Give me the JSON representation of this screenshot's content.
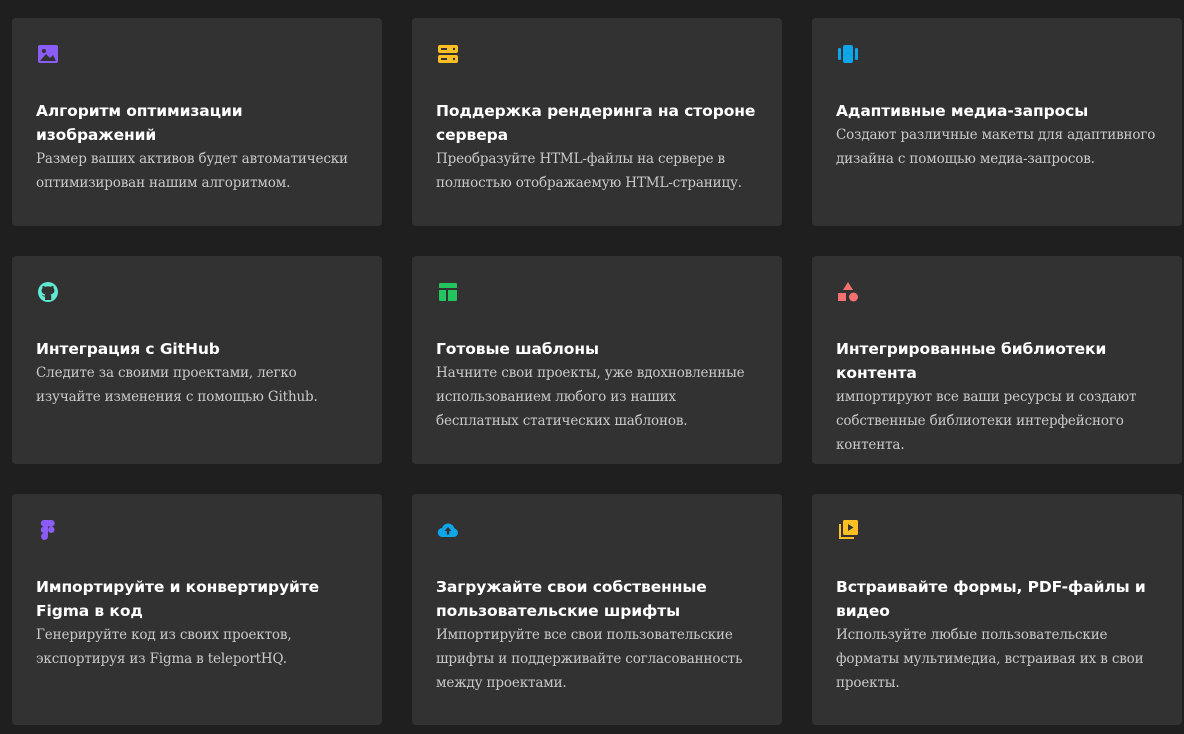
{
  "cards": [
    {
      "icon": "image-icon",
      "icon_color": "#8b5cf6",
      "title": "Алгоритм оптимизации изображений",
      "description": "Размер ваших активов будет автоматически оптимизирован нашим алгоритмом."
    },
    {
      "icon": "server-icon",
      "icon_color": "#fbbf24",
      "title": "Поддержка рендеринга на стороне сервера",
      "description": "Преобразуйте HTML-файлы на сервере в полностью отображаемую HTML-страницу."
    },
    {
      "icon": "responsive-icon",
      "icon_color": "#0ea5e9",
      "title": "Адаптивные медиа-запросы",
      "description": "Создают различные макеты для адаптивного дизайна с помощью медиа-запросов."
    },
    {
      "icon": "github-icon",
      "icon_color": "#5eead4",
      "title": "Интеграция с GitHub",
      "description": "Следите за своими проектами, легко изучайте изменения с помощью Github."
    },
    {
      "icon": "template-icon",
      "icon_color": "#22c55e",
      "title": "Готовые шаблоны",
      "description": "Начните свои проекты, уже вдохновленные использованием любого из наших бесплатных статических шаблонов."
    },
    {
      "icon": "shapes-icon",
      "icon_color": "#f87171",
      "title": "Интегрированные библиотеки контента",
      "description": "импортируют все ваши ресурсы и создают собственные библиотеки интерфейсного контента."
    },
    {
      "icon": "figma-icon",
      "icon_color": "#8b5cf6",
      "title": "Импортируйте и конвертируйте Figma в код",
      "description": "Генерируйте код из своих проектов, экспортируя из Figma в teleportHQ."
    },
    {
      "icon": "cloud-upload-icon",
      "icon_color": "#0ea5e9",
      "title": "Загружайте свои собственные пользовательские шрифты",
      "description": "Импортируйте все свои пользовательские шрифты и поддерживайте согласованность между проектами."
    },
    {
      "icon": "video-library-icon",
      "icon_color": "#fbbf24",
      "title": "Встраивайте формы, PDF-файлы и видео",
      "description": "Используйте любые пользовательские форматы мультимедиа, встраивая их в свои проекты."
    }
  ]
}
